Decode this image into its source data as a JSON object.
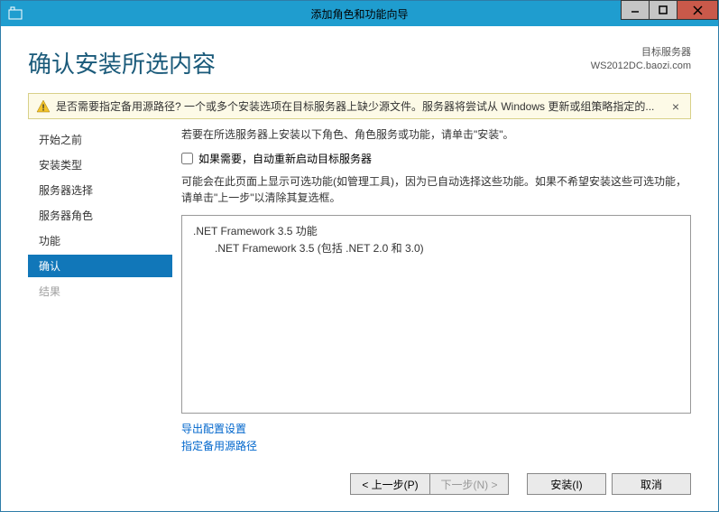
{
  "window": {
    "title": "添加角色和功能向导"
  },
  "header": {
    "page_title": "确认安装所选内容",
    "target_label": "目标服务器",
    "target_value": "WS2012DC.baozi.com"
  },
  "warning": {
    "text": "是否需要指定备用源路径? 一个或多个安装选项在目标服务器上缺少源文件。服务器将尝试从 Windows 更新或组策略指定的..."
  },
  "sidebar": {
    "items": [
      {
        "label": "开始之前",
        "state": "normal"
      },
      {
        "label": "安装类型",
        "state": "normal"
      },
      {
        "label": "服务器选择",
        "state": "normal"
      },
      {
        "label": "服务器角色",
        "state": "normal"
      },
      {
        "label": "功能",
        "state": "normal"
      },
      {
        "label": "确认",
        "state": "active"
      },
      {
        "label": "结果",
        "state": "disabled"
      }
    ]
  },
  "content": {
    "intro": "若要在所选服务器上安装以下角色、角色服务或功能，请单击\"安装\"。",
    "checkbox_label": "如果需要，自动重新启动目标服务器",
    "description": "可能会在此页面上显示可选功能(如管理工具)，因为已自动选择这些功能。如果不希望安装这些可选功能，请单击\"上一步\"以清除其复选框。",
    "list": {
      "item1": ".NET Framework 3.5 功能",
      "item2": ".NET Framework 3.5 (包括 .NET 2.0 和 3.0)"
    },
    "links": {
      "export": "导出配置设置",
      "alt_source": "指定备用源路径"
    }
  },
  "footer": {
    "prev": "< 上一步(P)",
    "next": "下一步(N) >",
    "install": "安装(I)",
    "cancel": "取消"
  }
}
